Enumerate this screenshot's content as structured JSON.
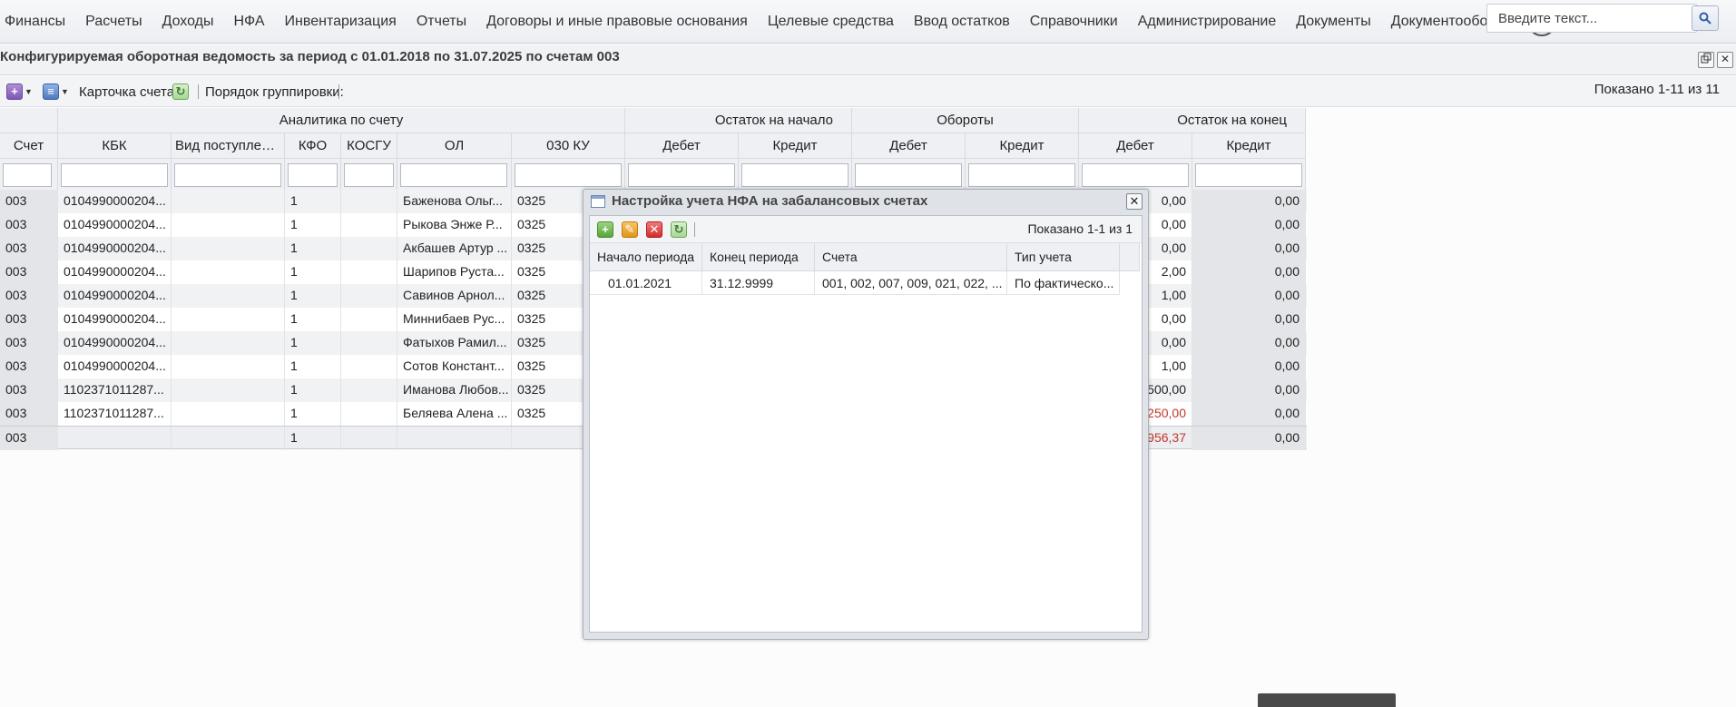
{
  "menu": {
    "items": [
      "Финансы",
      "Расчеты",
      "Доходы",
      "НФА",
      "Инвентаризация",
      "Отчеты",
      "Договоры и иные правовые основания",
      "Целевые средства",
      "Ввод остатков",
      "Справочники",
      "Администрирование",
      "Документы",
      "Документооборот"
    ],
    "search_placeholder": "Введите текст..."
  },
  "window": {
    "title": "Конфигурируемая оборотная ведомость за период с 01.01.2018 по 31.07.2025 по счетам 003"
  },
  "toolbar": {
    "card_label": "Карточка счета",
    "grouping_label": "Порядок группировки:",
    "shown": "Показано 1-11 из 11"
  },
  "grid": {
    "group_headers": {
      "analytics": "Аналитика по счету",
      "opening": "Остаток на начало",
      "turnover": "Обороты",
      "closing": "Остаток на конец"
    },
    "columns": [
      "Счет",
      "КБК",
      "Вид поступлени...",
      "КФО",
      "КОСГУ",
      "ОЛ",
      "030 КУ",
      "Дебет",
      "Кредит",
      "Дебет",
      "Кредит",
      "Дебет",
      "Кредит"
    ],
    "rows": [
      {
        "acc": "003",
        "kbk": "0104990000204...",
        "kfo": "1",
        "ol": "Баженова Ольг...",
        "ku": "0325",
        "cd": "0,00",
        "cc": "0,00",
        "neg": false
      },
      {
        "acc": "003",
        "kbk": "0104990000204...",
        "kfo": "1",
        "ol": "Рыкова Энже Р...",
        "ku": "0325",
        "cd": "0,00",
        "cc": "0,00",
        "neg": false
      },
      {
        "acc": "003",
        "kbk": "0104990000204...",
        "kfo": "1",
        "ol": "Акбашев Артур ...",
        "ku": "0325",
        "cd": "0,00",
        "cc": "0,00",
        "neg": false
      },
      {
        "acc": "003",
        "kbk": "0104990000204...",
        "kfo": "1",
        "ol": "Шарипов Руста...",
        "ku": "0325",
        "cd": "2,00",
        "cc": "0,00",
        "neg": false
      },
      {
        "acc": "003",
        "kbk": "0104990000204...",
        "kfo": "1",
        "ol": "Савинов Арнол...",
        "ku": "0325",
        "cd": "1,00",
        "cc": "0,00",
        "neg": false
      },
      {
        "acc": "003",
        "kbk": "0104990000204...",
        "kfo": "1",
        "ol": "Миннибаев Рус...",
        "ku": "0325",
        "cd": "0,00",
        "cc": "0,00",
        "neg": false
      },
      {
        "acc": "003",
        "kbk": "0104990000204...",
        "kfo": "1",
        "ol": "Фатыхов Рамил...",
        "ku": "0325",
        "cd": "0,00",
        "cc": "0,00",
        "neg": false
      },
      {
        "acc": "003",
        "kbk": "0104990000204...",
        "kfo": "1",
        "ol": "Сотов Констант...",
        "ku": "0325",
        "cd": "1,00",
        "cc": "0,00",
        "neg": false
      },
      {
        "acc": "003",
        "kbk": "1102371011287...",
        "kfo": "1",
        "ol": "Иманова Любов...",
        "ku": "0325",
        "cd": "500,00",
        "cc": "0,00",
        "neg": false
      },
      {
        "acc": "003",
        "kbk": "1102371011287...",
        "kfo": "1",
        "ol": "Беляева Алена ...",
        "ku": "0325",
        "cd": "250,00",
        "cc": "0,00",
        "neg": true
      },
      {
        "acc": "003",
        "kbk": "",
        "kfo": "1",
        "ol": "",
        "ku": "",
        "cd": "956,37",
        "cc": "0,00",
        "neg": true
      }
    ]
  },
  "dialog": {
    "title": "Настройка учета НФА на забалансовых счетах",
    "shown": "Показано 1-1 из 1",
    "columns": [
      "Начало периода",
      "Конец периода",
      "Счета",
      "Тип учета"
    ],
    "rows": [
      {
        "start": "01.01.2021",
        "end": "31.12.9999",
        "accounts": "001, 002, 007, 009, 021, 022, ...",
        "type": "По фактическо..."
      }
    ]
  },
  "colors": {
    "negative": "#c0392b",
    "header_bg": "#eef0f3",
    "dark_cell": "#e4e5e8"
  }
}
